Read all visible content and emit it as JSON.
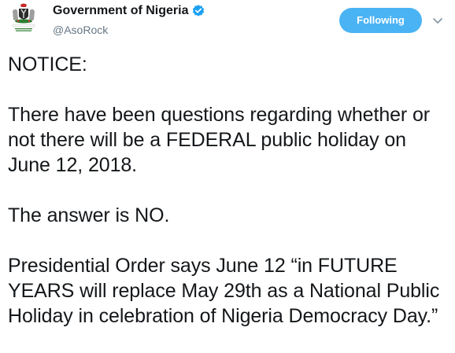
{
  "account": {
    "display_name": "Government of Nigeria",
    "handle": "@AsoRock",
    "verified": true,
    "avatar_icon": "nigeria-coat-of-arms-logo",
    "avatar_text": "NIGERIA"
  },
  "actions": {
    "follow_label": "Following",
    "follow_color": "#4ab3f4",
    "menu_icon": "chevron-down-icon"
  },
  "tweet": {
    "paragraphs": [
      "NOTICE:",
      "There have been questions regarding whether or not there will be a FEDERAL public holiday on June 12, 2018.",
      "The answer is NO.",
      "Presidential Order says June 12 “in FUTURE YEARS will replace May 29th as a National Public Holiday in celebration of Nigeria Democracy Day.”"
    ]
  },
  "colors": {
    "text": "#14171a",
    "secondary_text": "#657786",
    "verified_badge": "#1da1f2"
  }
}
